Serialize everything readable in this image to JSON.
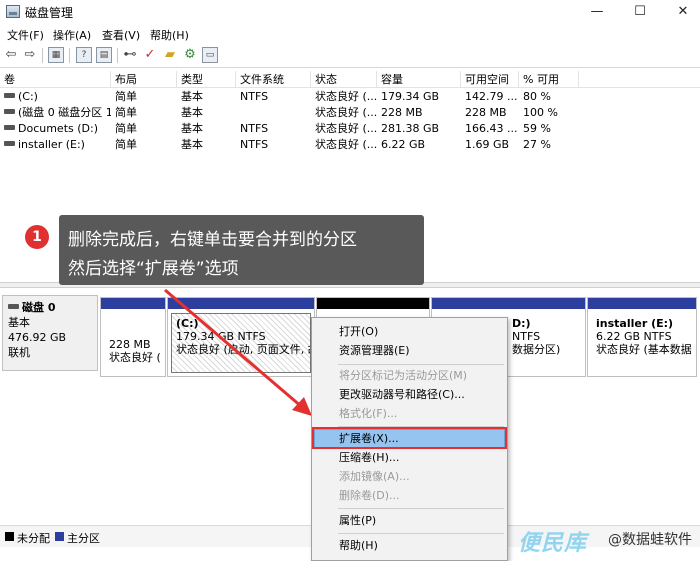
{
  "window": {
    "title": "磁盘管理",
    "minimize_glyph": "—",
    "maximize_glyph": "☐",
    "close_glyph": "✕"
  },
  "menubar": [
    "文件(F)",
    "操作(A)",
    "查看(V)",
    "帮助(H)"
  ],
  "toolbar": {
    "icons": [
      "back-arrow-icon",
      "forward-arrow-icon",
      "properties-icon",
      "help-icon",
      "connect-icon",
      "check-icon",
      "folder-icon",
      "settings-icon"
    ],
    "help_glyph": "?"
  },
  "volume_table": {
    "columns": [
      "卷",
      "布局",
      "类型",
      "文件系统",
      "状态",
      "容量",
      "可用空间",
      "% 可用"
    ],
    "rows": [
      [
        "(C:)",
        "简单",
        "基本",
        "NTFS",
        "状态良好 (...",
        "179.34 GB",
        "142.79 ...",
        "80 %"
      ],
      [
        "(磁盘 0 磁盘分区 1)",
        "简单",
        "基本",
        "",
        "状态良好 (...",
        "228 MB",
        "228 MB",
        "100 %"
      ],
      [
        "Documets (D:)",
        "简单",
        "基本",
        "NTFS",
        "状态良好 (...",
        "281.38 GB",
        "166.43 ...",
        "59 %"
      ],
      [
        "installer (E:)",
        "简单",
        "基本",
        "NTFS",
        "状态良好 (...",
        "6.22 GB",
        "1.69 GB",
        "27 %"
      ]
    ]
  },
  "disk": {
    "name": "磁盘 0",
    "type": "基本",
    "size": "476.92 GB",
    "status": "联机",
    "partitions": [
      {
        "name": "",
        "size": "228 MB",
        "status": "状态良好 (E"
      },
      {
        "name": "(C:)",
        "size": "179.34 GB NTFS",
        "status": "状态良好 (启动, 页面文件, 故障"
      },
      {
        "name": "",
        "size": "",
        "status": ""
      },
      {
        "name": "D:)",
        "size": "NTFS",
        "status": "数据分区)"
      },
      {
        "name": "installer  (E:)",
        "size": "6.22 GB NTFS",
        "status": "状态良好 (基本数据分"
      }
    ]
  },
  "legend": {
    "unallocated": "未分配",
    "primary": "主分区",
    "unallocated_color": "#000000",
    "primary_color": "#2c3e9e"
  },
  "callout": {
    "step": "1",
    "line1": "删除完成后，右键单击要合并到的分区",
    "line2": "然后选择“扩展卷”选项"
  },
  "context_menu": {
    "items": [
      {
        "label": "打开(O)",
        "enabled": true
      },
      {
        "label": "资源管理器(E)",
        "enabled": true
      },
      {
        "label": "将分区标记为活动分区(M)",
        "enabled": false
      },
      {
        "label": "更改驱动器号和路径(C)...",
        "enabled": true
      },
      {
        "label": "格式化(F)...",
        "enabled": false
      },
      {
        "label": "扩展卷(X)...",
        "enabled": true,
        "highlighted": true
      },
      {
        "label": "压缩卷(H)...",
        "enabled": true
      },
      {
        "label": "添加镜像(A)...",
        "enabled": false
      },
      {
        "label": "删除卷(D)...",
        "enabled": false
      },
      {
        "label": "属性(P)",
        "enabled": true
      },
      {
        "label": "帮助(H)",
        "enabled": true
      }
    ]
  },
  "watermark": {
    "brand": "便民库",
    "text": "@数据蛙软件"
  },
  "colors": {
    "accent_red": "#e53030",
    "callout_bg": "#595959",
    "menu_highlight": "#94c4ef",
    "partition_header": "#2c3e9e"
  }
}
